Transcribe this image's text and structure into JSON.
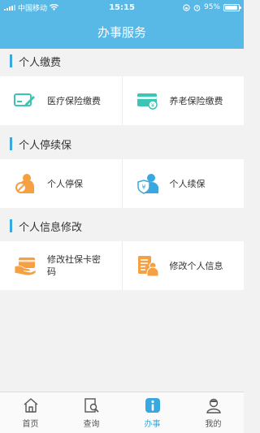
{
  "status": {
    "carrier": "中国移动",
    "time": "15:15",
    "battery": "95%",
    "battery_level": 0.95
  },
  "header": {
    "title": "办事服务"
  },
  "sections": [
    {
      "title": "个人缴费",
      "items": [
        {
          "label": "医疗保险缴费",
          "icon": "card-pen-icon"
        },
        {
          "label": "养老保险缴费",
          "icon": "card-coin-icon"
        }
      ]
    },
    {
      "title": "个人停续保",
      "items": [
        {
          "label": "个人停保",
          "icon": "person-stop-icon"
        },
        {
          "label": "个人续保",
          "icon": "person-shield-icon"
        }
      ]
    },
    {
      "title": "个人信息修改",
      "items": [
        {
          "label": "修改社保卡密码",
          "icon": "hand-card-icon"
        },
        {
          "label": "修改个人信息",
          "icon": "profile-doc-icon"
        }
      ]
    }
  ],
  "tabs": [
    {
      "label": "首页",
      "icon": "home-icon"
    },
    {
      "label": "查询",
      "icon": "search-doc-icon"
    },
    {
      "label": "办事",
      "icon": "info-icon",
      "active": true
    },
    {
      "label": "我的",
      "icon": "user-icon"
    }
  ],
  "colors": {
    "brand": "#58b8e6",
    "accent": "#3aa8e0",
    "teal": "#3cc4b4",
    "orange": "#f5a043"
  }
}
